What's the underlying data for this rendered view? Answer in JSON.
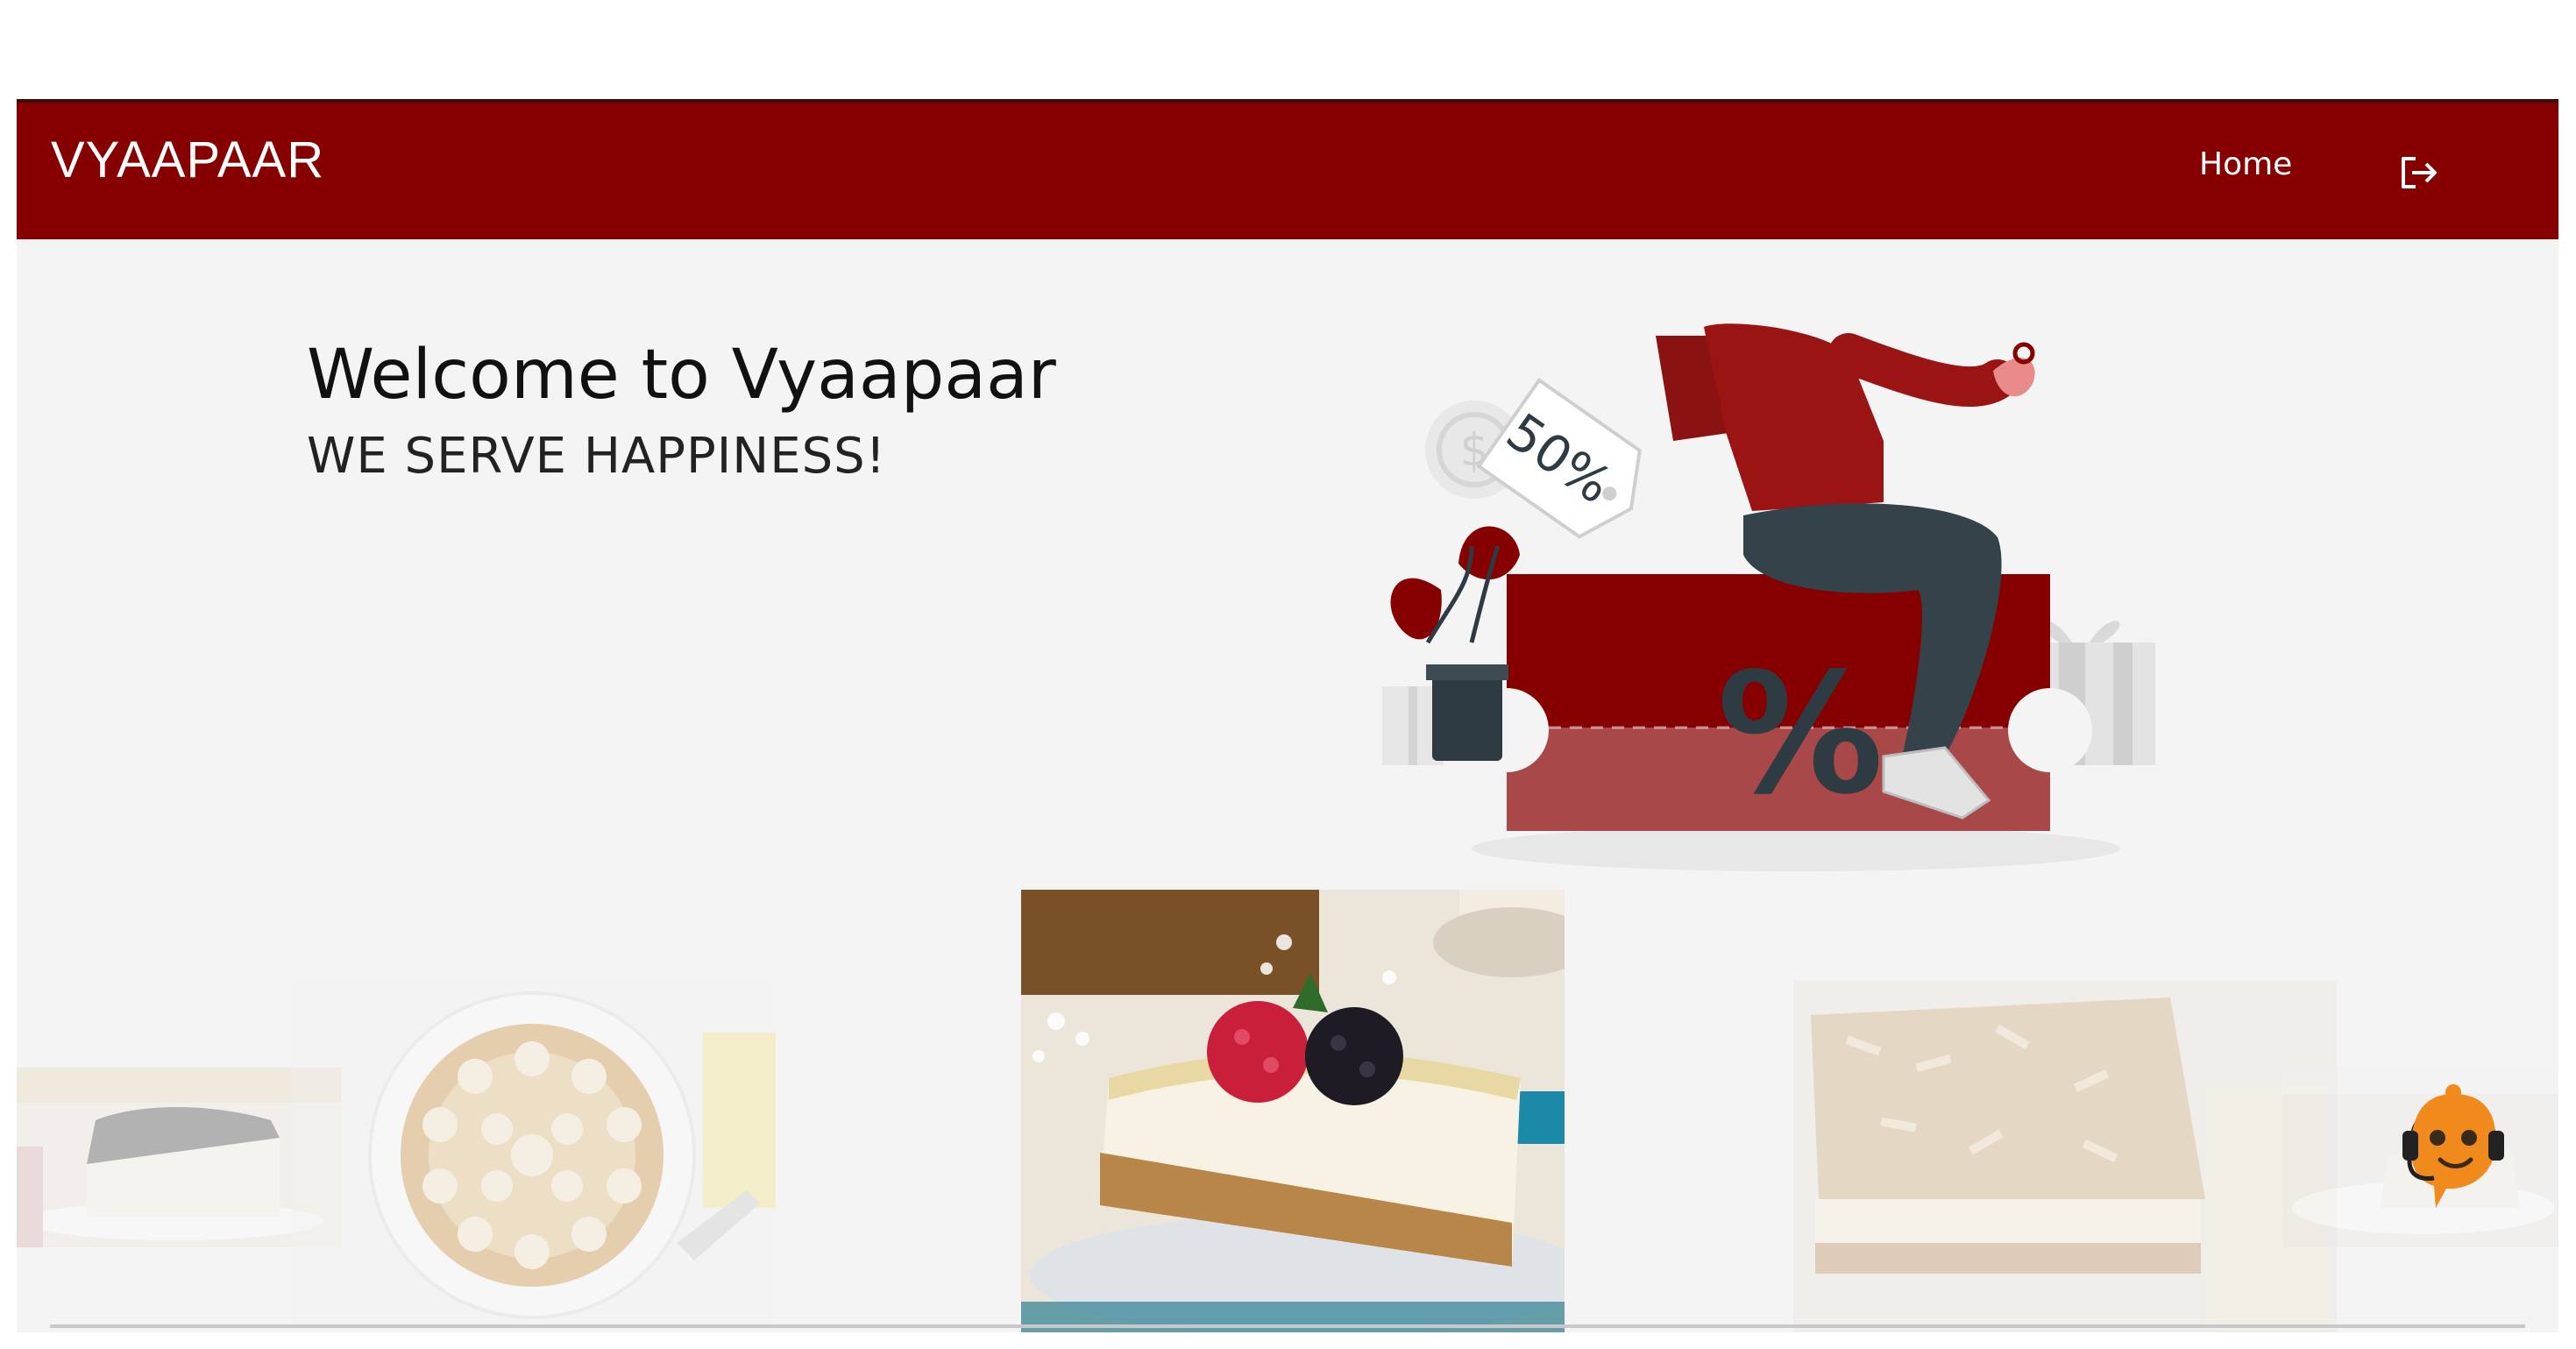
{
  "navbar": {
    "brand": "VYAAPAAR",
    "home_label": "Home",
    "logout_icon": "logout-icon"
  },
  "hero": {
    "title": "Welcome to Vyaapaar",
    "subtitle": "WE SERVE HAPPINESS!",
    "illustration": {
      "tag_text": "50%",
      "coupon_symbol": "%"
    }
  },
  "carousel": {
    "items": [
      {
        "name": "slice-cake",
        "state": "faded"
      },
      {
        "name": "banoffee-pie",
        "state": "faded"
      },
      {
        "name": "cheesecake-with-berries",
        "state": "active"
      },
      {
        "name": "almond-cake",
        "state": "faded"
      },
      {
        "name": "cake-slice-right",
        "state": "faded"
      }
    ]
  },
  "chatbot": {
    "icon": "chatbot-headset-icon"
  },
  "colors": {
    "brand": "#860000",
    "background": "#f4f4f4",
    "coupon_light": "#a94848"
  }
}
